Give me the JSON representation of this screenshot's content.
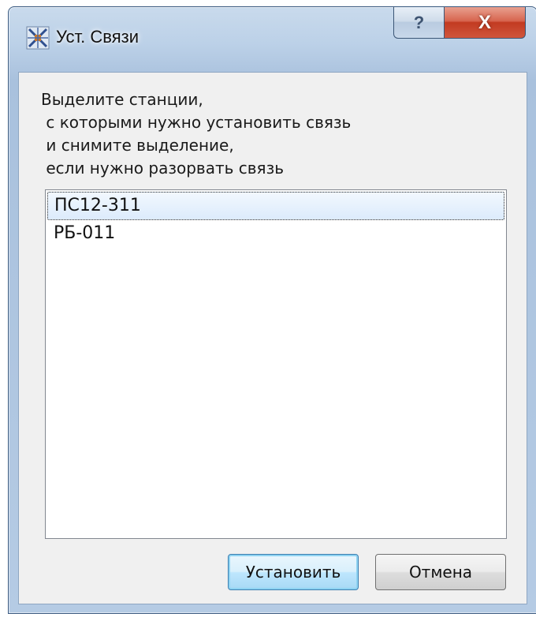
{
  "window": {
    "title": "Уст. Связи",
    "icon": "app-grid-icon",
    "help_label": "?",
    "close_label": "X"
  },
  "instructions": {
    "lines": [
      "Выделите станции,",
      " с которыми нужно установить связь",
      " и снимите выделение,",
      " если нужно разорвать связь"
    ]
  },
  "stations": [
    {
      "label": "ПС12-311",
      "selected": true
    },
    {
      "label": "РБ-011",
      "selected": false
    }
  ],
  "buttons": {
    "ok_label": "Установить",
    "cancel_label": "Отмена"
  }
}
